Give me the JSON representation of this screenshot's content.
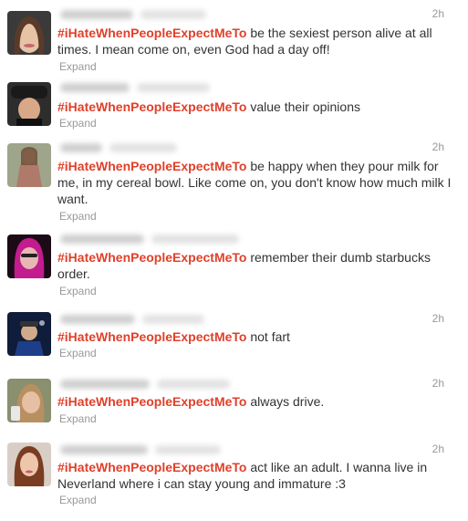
{
  "tweets": [
    {
      "time": "2h",
      "hashtag": "#iHateWhenPeopleExpectMeTo",
      "text": " be the sexiest person alive at all times. I mean come on, even God had a day off!",
      "expand": "Expand"
    },
    {
      "time": "",
      "hashtag": "#iHateWhenPeopleExpectMeTo",
      "text": " value their opinions",
      "expand": "Expand"
    },
    {
      "time": "2h",
      "hashtag": "#iHateWhenPeopleExpectMeTo",
      "text": " be happy when they pour milk for me, in my cereal bowl. Like come on, you don't know how much milk I want.",
      "expand": "Expand"
    },
    {
      "time": "",
      "hashtag": "#iHateWhenPeopleExpectMeTo",
      "text": " remember their dumb starbucks order.",
      "expand": "Expand"
    },
    {
      "time": "2h",
      "hashtag": "#iHateWhenPeopleExpectMeTo",
      "text": " not fart",
      "expand": "Expand"
    },
    {
      "time": "2h",
      "hashtag": "#iHateWhenPeopleExpectMeTo",
      "text": " always drive.",
      "expand": "Expand"
    },
    {
      "time": "2h",
      "hashtag": "#iHateWhenPeopleExpectMeTo",
      "text": " act like an adult. I wanna live in Neverland where i can stay young and immature :3",
      "expand": "Expand"
    }
  ]
}
